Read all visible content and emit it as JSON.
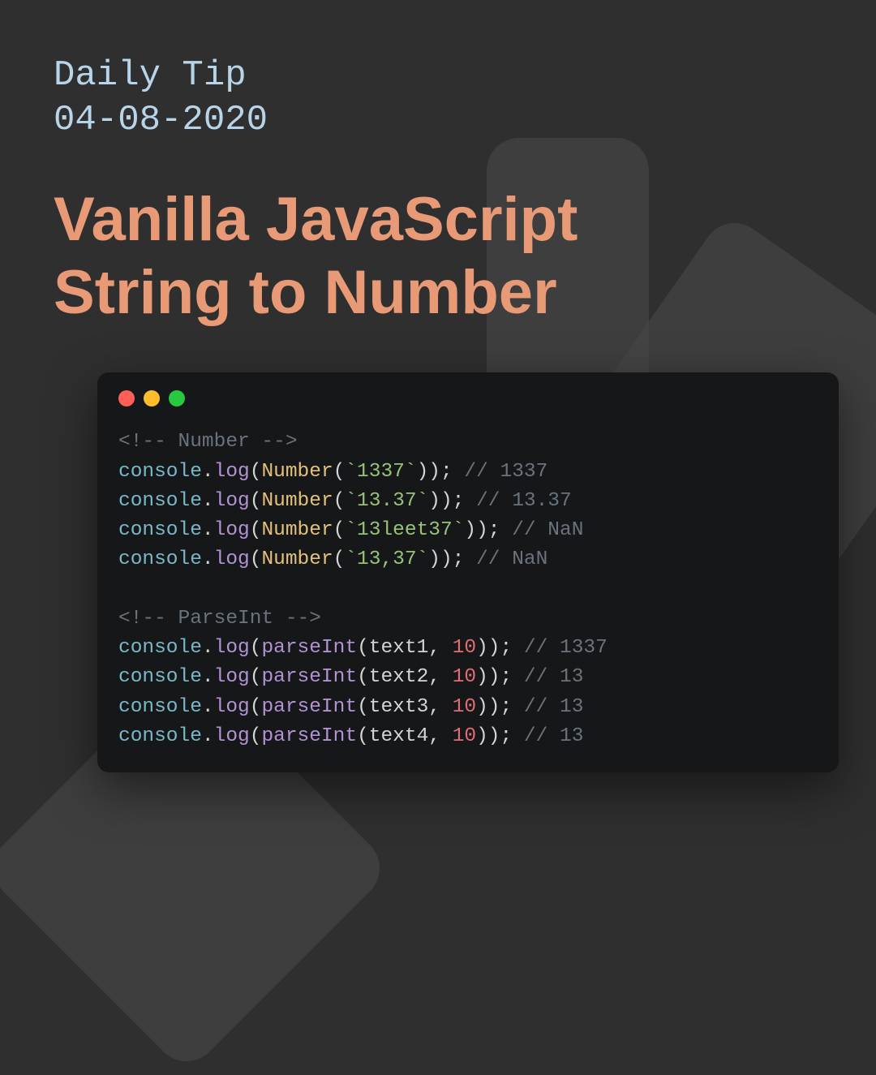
{
  "subtitle_line1": "Daily Tip",
  "subtitle_line2": "04-08-2020",
  "title_line1": "Vanilla JavaScript",
  "title_line2": "String to Number",
  "code": {
    "section1_comment": "<!-- Number -->",
    "lines1": [
      {
        "obj": "console",
        "fn": "log",
        "call": "Number",
        "str": "`1337`",
        "cmt": "// 1337"
      },
      {
        "obj": "console",
        "fn": "log",
        "call": "Number",
        "str": "`13.37`",
        "cmt": "// 13.37"
      },
      {
        "obj": "console",
        "fn": "log",
        "call": "Number",
        "str": "`13leet37`",
        "cmt": "// NaN"
      },
      {
        "obj": "console",
        "fn": "log",
        "call": "Number",
        "str": "`13,37`",
        "cmt": "// NaN"
      }
    ],
    "section2_comment": "<!-- ParseInt -->",
    "lines2": [
      {
        "obj": "console",
        "fn": "log",
        "call": "parseInt",
        "var": "text1",
        "num": "10",
        "cmt": "// 1337"
      },
      {
        "obj": "console",
        "fn": "log",
        "call": "parseInt",
        "var": "text2",
        "num": "10",
        "cmt": "// 13"
      },
      {
        "obj": "console",
        "fn": "log",
        "call": "parseInt",
        "var": "text3",
        "num": "10",
        "cmt": "// 13"
      },
      {
        "obj": "console",
        "fn": "log",
        "call": "parseInt",
        "var": "text4",
        "num": "10",
        "cmt": "// 13"
      }
    ]
  }
}
